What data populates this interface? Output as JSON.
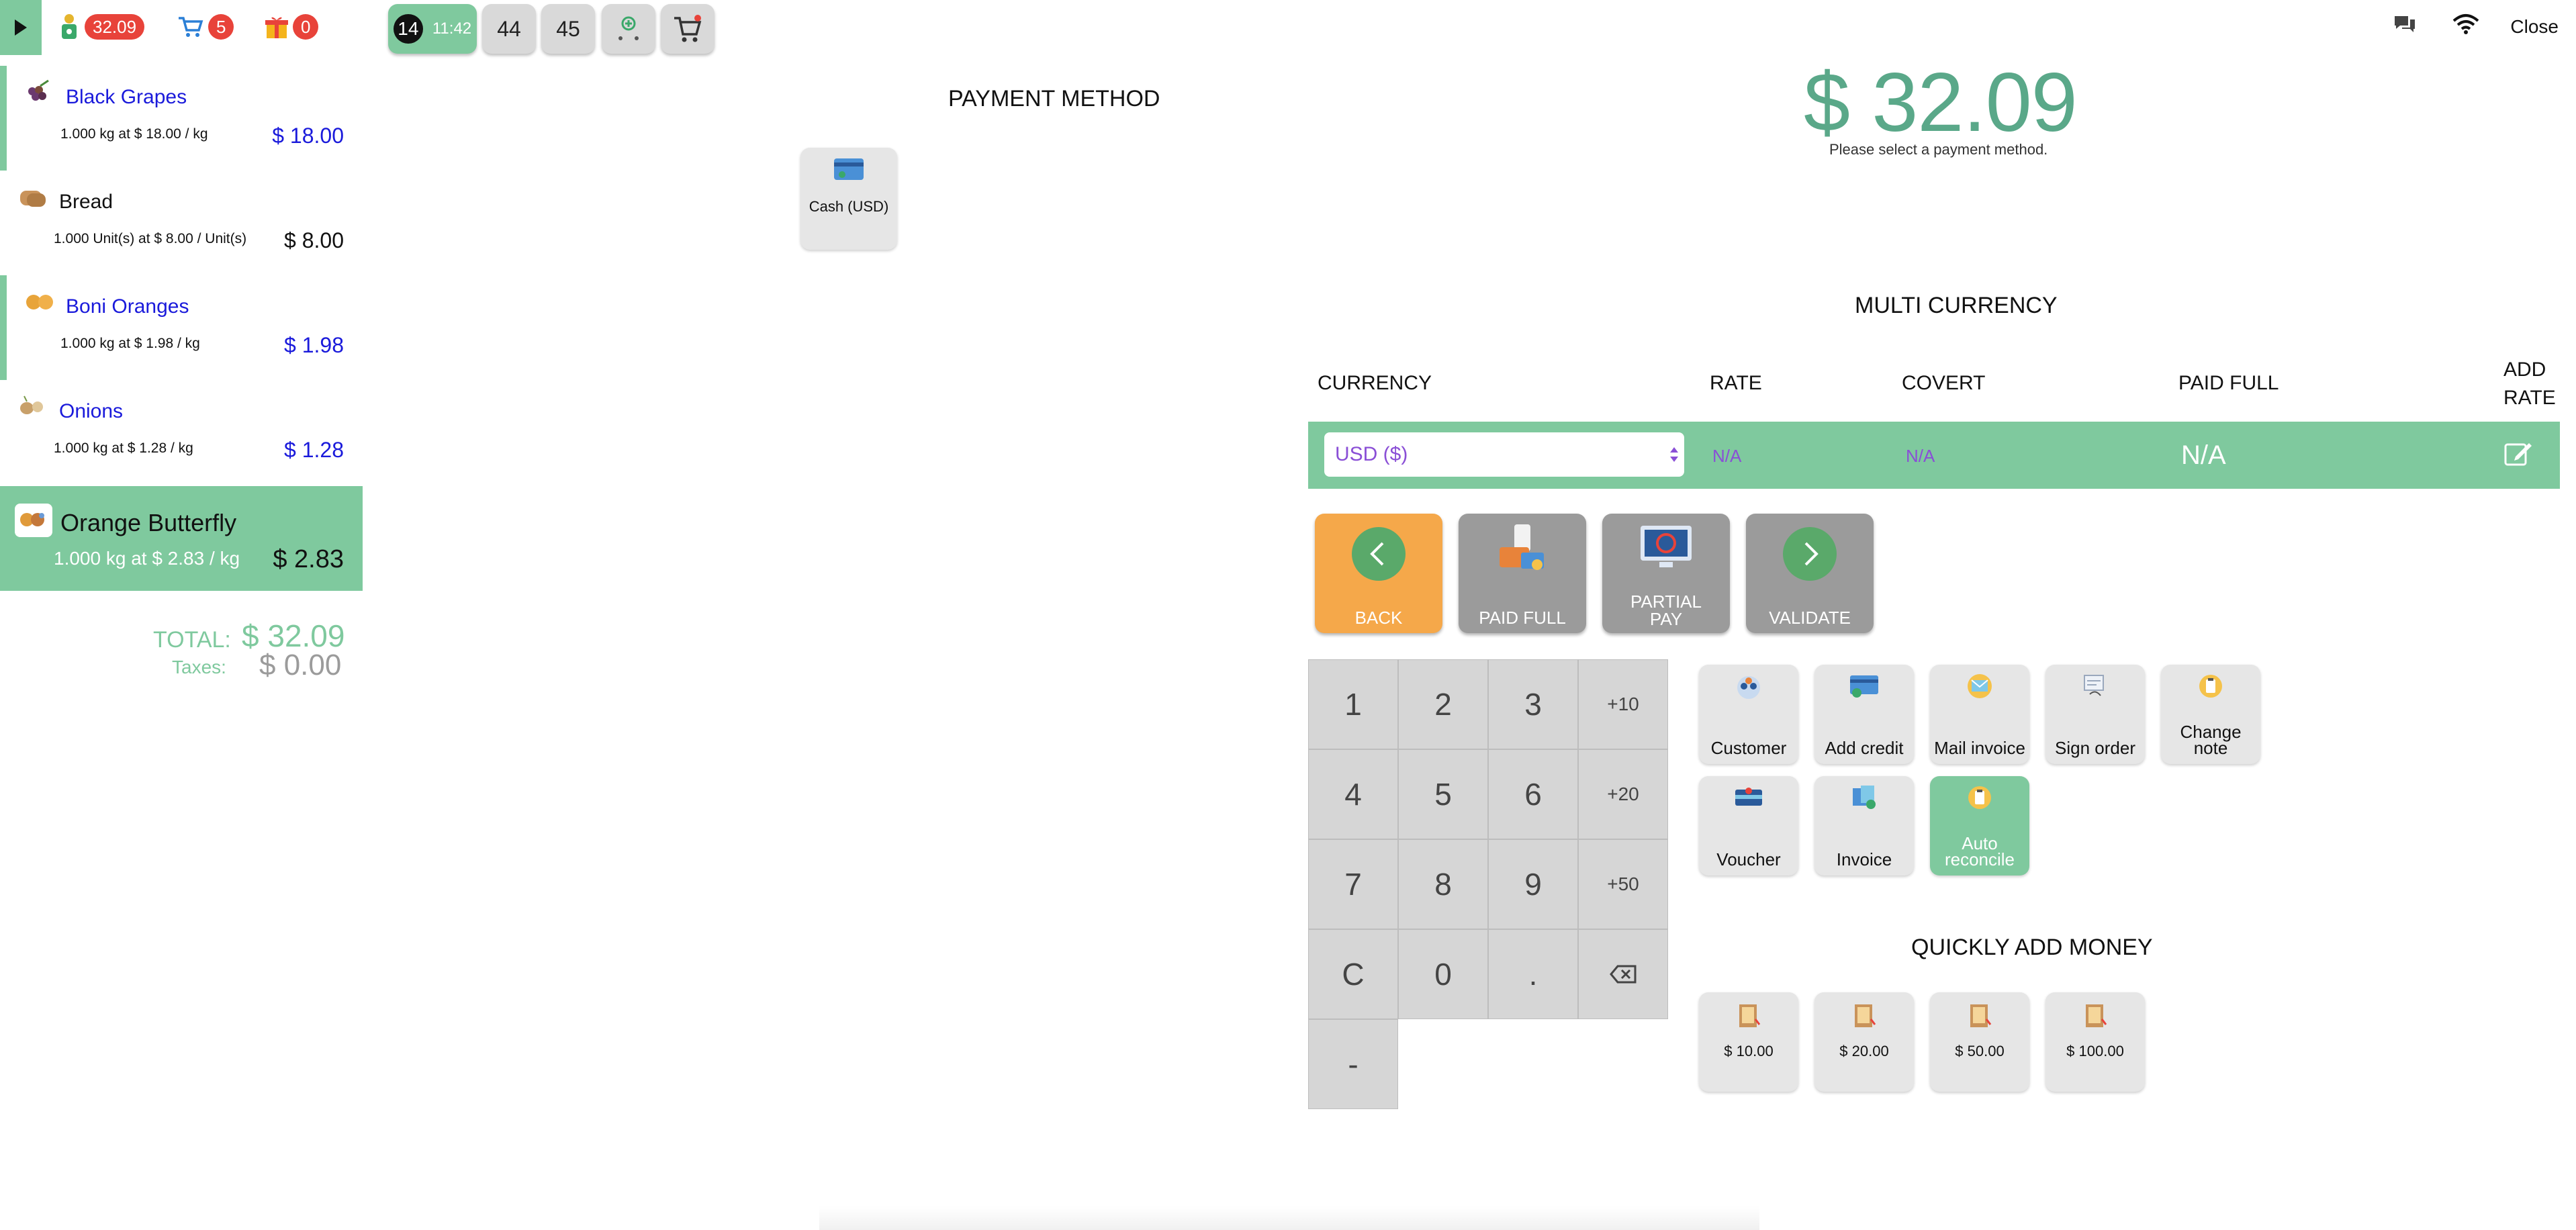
{
  "topbar": {
    "toggle_icon": "play-triangle-icon",
    "counters": [
      {
        "icon": "price-tag-person-icon",
        "value": "32.09"
      },
      {
        "icon": "cart-icon",
        "value": "5"
      },
      {
        "icon": "gift-icon",
        "value": "0"
      }
    ],
    "order_tabs": [
      {
        "number": "14",
        "time": "11:42",
        "active": true
      },
      {
        "number": "44"
      },
      {
        "number": "45"
      }
    ],
    "add_order_icon": "add-order-icon",
    "cart_icon": "cart-add-icon",
    "close_label": "Close",
    "status_icons": [
      "chat-icon",
      "wifi-icon"
    ]
  },
  "order_lines": [
    {
      "name": "Black Grapes",
      "detail": "1.000 kg at $ 18.00 / kg",
      "price": "$ 18.00",
      "icon": "grapes-icon"
    },
    {
      "name": "Bread",
      "detail": "1.000 Unit(s) at $ 8.00 / Unit(s)",
      "price": "$ 8.00",
      "icon": "bread-icon"
    },
    {
      "name": "Boni Oranges",
      "detail": "1.000 kg at $ 1.98 / kg",
      "price": "$ 1.98",
      "icon": "oranges-icon"
    },
    {
      "name": "Onions",
      "detail": "1.000 kg at $ 1.28 / kg",
      "price": "$ 1.28",
      "icon": "onion-icon"
    },
    {
      "name": "Orange Butterfly",
      "detail": "1.000 kg at $ 2.83 / kg",
      "price": "$ 2.83",
      "icon": "butterfly-orange-icon"
    }
  ],
  "totals": {
    "total_label": "TOTAL:",
    "total_value": "$ 32.09",
    "taxes_label": "Taxes:",
    "taxes_value": "$ 0.00"
  },
  "payment_method": {
    "title": "PAYMENT METHOD",
    "methods": [
      {
        "label": "Cash (USD)",
        "icon": "cash-card-icon"
      }
    ]
  },
  "summary": {
    "amount": "$ 32.09",
    "hint": "Please select a payment method."
  },
  "multi_currency": {
    "title": "MULTI CURRENCY",
    "headers": {
      "currency": "CURRENCY",
      "rate": "RATE",
      "covert": "COVERT",
      "paid_full": "PAID FULL",
      "add_rate_1": "ADD",
      "add_rate_2": "RATE"
    },
    "row": {
      "currency": "USD ($)",
      "rate": "N/A",
      "covert": "N/A",
      "paid_full": "N/A"
    }
  },
  "actions": {
    "back": "BACK",
    "paid_full": "PAID FULL",
    "partial_pay_1": "PARTIAL",
    "partial_pay_2": "PAY",
    "validate": "VALIDATE",
    "colors": {
      "back": "#f5a84a",
      "gray": "#9b9b9b"
    }
  },
  "numpad": {
    "keys": [
      "1",
      "2",
      "3",
      "+10",
      "4",
      "5",
      "6",
      "+20",
      "7",
      "8",
      "9",
      "+50",
      "C",
      "0",
      ".",
      "⌫",
      "-"
    ]
  },
  "options": [
    {
      "label": "Customer",
      "icon": "customer-icon"
    },
    {
      "label": "Add credit",
      "icon": "credit-card-icon"
    },
    {
      "label": "Mail invoice",
      "icon": "mail-invoice-icon"
    },
    {
      "label": "Sign order",
      "icon": "sign-order-icon"
    },
    {
      "label": "Change",
      "label2": "note",
      "icon": "change-note-icon"
    },
    {
      "label": "Voucher",
      "icon": "voucher-icon"
    },
    {
      "label": "Invoice",
      "icon": "invoice-icon"
    },
    {
      "label": "Auto",
      "label2": "reconcile",
      "icon": "auto-reconcile-icon"
    }
  ],
  "quick_add": {
    "title": "QUICKLY ADD MONEY",
    "amounts": [
      "$ 10.00",
      "$ 20.00",
      "$ 50.00",
      "$ 100.00"
    ],
    "icon": "money-box-icon"
  },
  "colors": {
    "accent_green": "#7fc99e",
    "badge_red": "#e8433a",
    "link_blue": "#1a1adb",
    "purple": "#8a4fd6"
  }
}
